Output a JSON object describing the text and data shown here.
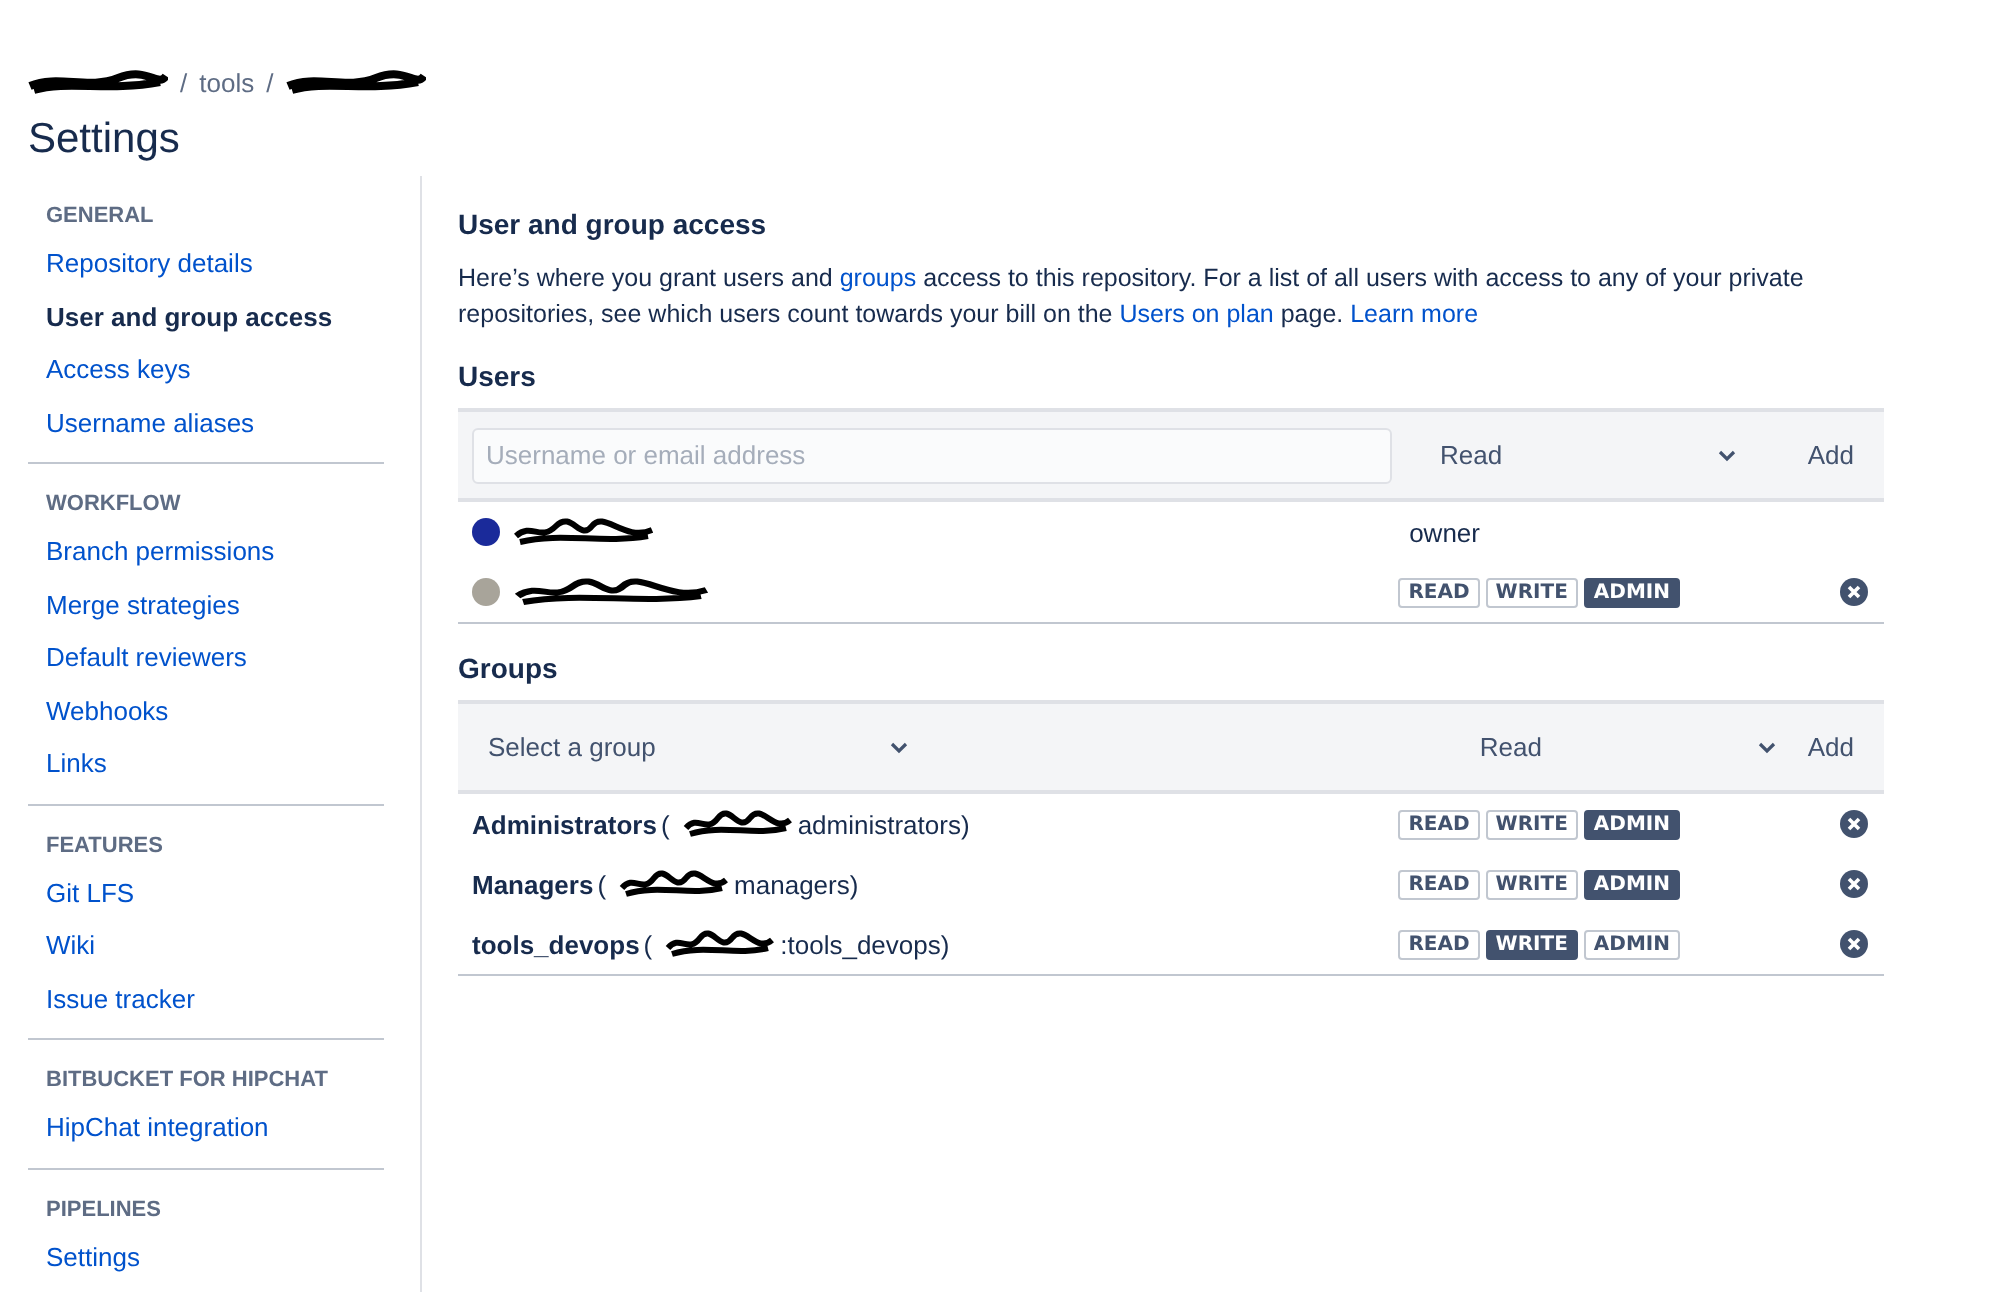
{
  "breadcrumb": [
    {
      "kind": "redacted"
    },
    {
      "kind": "text",
      "text": "/"
    },
    {
      "kind": "text",
      "text": "tools"
    },
    {
      "kind": "text",
      "text": "/"
    },
    {
      "kind": "redacted"
    }
  ],
  "page_title": "Settings",
  "sidebar": [
    {
      "heading": "GENERAL",
      "items": [
        {
          "label": "Repository details",
          "selected": false
        },
        {
          "label": "User and group access",
          "selected": true
        },
        {
          "label": "Access keys",
          "selected": false
        },
        {
          "label": "Username aliases",
          "selected": false
        }
      ]
    },
    {
      "heading": "WORKFLOW",
      "items": [
        {
          "label": "Branch permissions",
          "selected": false
        },
        {
          "label": "Merge strategies",
          "selected": false
        },
        {
          "label": "Default reviewers",
          "selected": false
        },
        {
          "label": "Webhooks",
          "selected": false
        },
        {
          "label": "Links",
          "selected": false
        }
      ]
    },
    {
      "heading": "FEATURES",
      "items": [
        {
          "label": "Git LFS",
          "selected": false
        },
        {
          "label": "Wiki",
          "selected": false
        },
        {
          "label": "Issue tracker",
          "selected": false
        }
      ]
    },
    {
      "heading": "BITBUCKET FOR HIPCHAT",
      "items": [
        {
          "label": "HipChat integration",
          "selected": false
        }
      ]
    },
    {
      "heading": "PIPELINES",
      "items": [
        {
          "label": "Settings",
          "selected": false
        }
      ]
    }
  ],
  "section_title": "User and group access",
  "intro": [
    {
      "kind": "text",
      "text": "Here’s where you grant users and"
    },
    {
      "kind": "link",
      "text": "groups"
    },
    {
      "kind": "text",
      "text": "access to this repository. For a list of all users with access to any of your private repositories, see which users count towards your bill on the"
    },
    {
      "kind": "link",
      "text": "Users on plan"
    },
    {
      "kind": "text",
      "text": "page."
    },
    {
      "kind": "link",
      "text": "Learn more"
    }
  ],
  "users": {
    "title": "Users",
    "search": {
      "placeholder": "Username or email address"
    },
    "permission": "Read",
    "add": "Add",
    "rows": [
      {
        "kind": "owner",
        "role": "owner"
      },
      {
        "kind": "permissions",
        "permissions": [
          {
            "label": "READ",
            "selected": false
          },
          {
            "label": "WRITE",
            "selected": false
          },
          {
            "label": "ADMIN",
            "selected": true
          }
        ]
      }
    ]
  },
  "groups": {
    "title": "Groups",
    "select": "Select a group",
    "permission": "Read",
    "add": "Add",
    "rows": [
      {
        "name": "Administrators",
        "before": "(",
        "after": "administrators)",
        "permissions": [
          {
            "label": "READ",
            "selected": false
          },
          {
            "label": "WRITE",
            "selected": false
          },
          {
            "label": "ADMIN",
            "selected": true
          }
        ]
      },
      {
        "name": "Managers",
        "before": "(",
        "after": "managers)",
        "permissions": [
          {
            "label": "READ",
            "selected": false
          },
          {
            "label": "WRITE",
            "selected": false
          },
          {
            "label": "ADMIN",
            "selected": true
          }
        ]
      },
      {
        "name": "tools_devops",
        "before": "(",
        "after": ":tools_devops)",
        "permissions": [
          {
            "label": "READ",
            "selected": false
          },
          {
            "label": "WRITE",
            "selected": true
          },
          {
            "label": "ADMIN",
            "selected": false
          }
        ]
      }
    ]
  }
}
